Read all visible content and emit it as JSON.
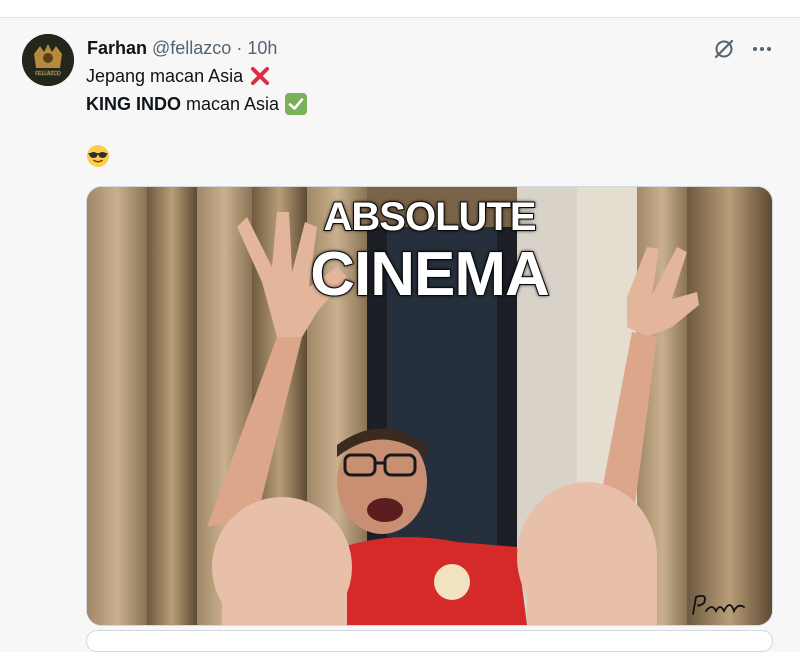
{
  "tweet": {
    "display_name": "Farhan",
    "handle": "@fellazco",
    "separator": "·",
    "time": "10h",
    "line1_text": "Jepang macan Asia",
    "line2_bold": "KING INDO",
    "line2_text": " macan Asia",
    "avatar_text": "FELLAZCO"
  },
  "media": {
    "caption_line1": "ABSOLUTE",
    "caption_line2": "CINEMA"
  },
  "icons": {
    "grok": "grok-icon",
    "more": "more-icon",
    "cross": "cross-mark-emoji",
    "check": "check-mark-emoji",
    "sunglasses": "sunglasses-emoji"
  },
  "colors": {
    "text": "#0f1419",
    "muted": "#536471",
    "cross_red": "#dd2e44",
    "check_green": "#78b159",
    "jersey_red": "#d62a2a"
  }
}
